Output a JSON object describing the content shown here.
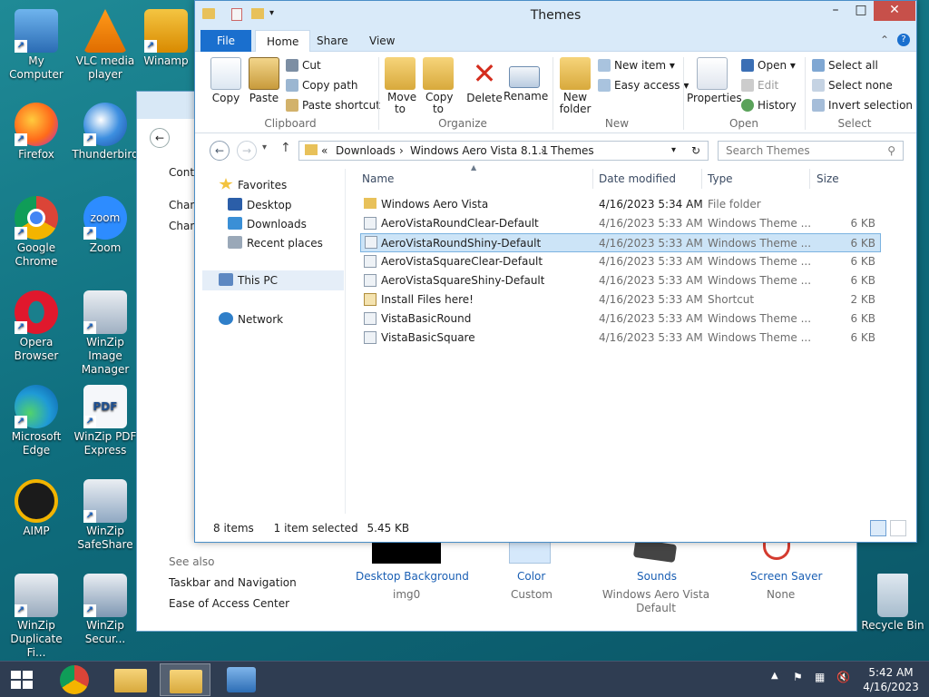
{
  "desktop": {
    "icons": [
      {
        "label": "My Computer",
        "icon": "computer-icon"
      },
      {
        "label": "VLC media player",
        "icon": "vlc-icon"
      },
      {
        "label": "Winamp",
        "icon": "winamp-icon"
      },
      {
        "label": "Firefox",
        "icon": "firefox-icon"
      },
      {
        "label": "Thunderbird",
        "icon": "thunderbird-icon"
      },
      {
        "label": "Google Chrome",
        "icon": "chrome-icon"
      },
      {
        "label": "Zoom",
        "icon": "zoom-icon"
      },
      {
        "label": "Opera Browser",
        "icon": "opera-icon"
      },
      {
        "label": "WinZip Image Manager",
        "icon": "winzip-image-icon"
      },
      {
        "label": "Microsoft Edge",
        "icon": "edge-icon"
      },
      {
        "label": "WinZip PDF Express",
        "icon": "winzip-pdf-icon"
      },
      {
        "label": "AIMP",
        "icon": "aimp-icon"
      },
      {
        "label": "WinZip SafeShare",
        "icon": "winzip-safeshare-icon"
      },
      {
        "label": "WinZip Duplicate Fi...",
        "icon": "winzip-duplicate-icon"
      },
      {
        "label": "WinZip Secur...",
        "icon": "winzip-secure-icon"
      },
      {
        "label": "Recycle Bin",
        "icon": "recycle-bin-icon"
      }
    ]
  },
  "control_panel": {
    "links": [
      "Contr",
      "Chan",
      "Chan"
    ],
    "see_also": "See also",
    "see_also_links": [
      "Taskbar and Navigation",
      "Ease of Access Center"
    ],
    "items": [
      {
        "label": "Desktop Background",
        "value": "img0"
      },
      {
        "label": "Color",
        "value": "Custom"
      },
      {
        "label": "Sounds",
        "value": "Windows Aero Vista Default"
      },
      {
        "label": "Screen Saver",
        "value": "None"
      }
    ]
  },
  "explorer": {
    "title": "Themes",
    "tabs": {
      "file": "File",
      "home": "Home",
      "share": "Share",
      "view": "View"
    },
    "ribbon": {
      "copy": "Copy",
      "paste": "Paste",
      "cut": "Cut",
      "copy_path": "Copy path",
      "paste_shortcut": "Paste shortcut",
      "clipboard": "Clipboard",
      "move_to": "Move to",
      "copy_to": "Copy to",
      "delete": "Delete",
      "rename": "Rename",
      "organize": "Organize",
      "new_folder": "New folder",
      "new_item": "New item",
      "easy_access": "Easy access",
      "new": "New",
      "properties": "Properties",
      "open": "Open",
      "edit": "Edit",
      "history": "History",
      "open_group": "Open",
      "select_all": "Select all",
      "select_none": "Select none",
      "invert_selection": "Invert selection",
      "select": "Select"
    },
    "address": {
      "prefix": "«",
      "crumbs": [
        "Downloads",
        "Windows Aero Vista 8.1.1",
        "Themes"
      ],
      "search_placeholder": "Search Themes"
    },
    "nav": {
      "favorites": "Favorites",
      "desktop": "Desktop",
      "downloads": "Downloads",
      "recent": "Recent places",
      "this_pc": "This PC",
      "network": "Network"
    },
    "columns": {
      "name": "Name",
      "date": "Date modified",
      "type": "Type",
      "size": "Size"
    },
    "files": [
      {
        "name": "Windows Aero Vista",
        "date": "4/16/2023 5:34 AM",
        "type": "File folder",
        "size": "",
        "kind": "folder"
      },
      {
        "name": "AeroVistaRoundClear-Default",
        "date": "4/16/2023 5:33 AM",
        "type": "Windows Theme ...",
        "size": "6 KB",
        "kind": "theme"
      },
      {
        "name": "AeroVistaRoundShiny-Default",
        "date": "4/16/2023 5:33 AM",
        "type": "Windows Theme ...",
        "size": "6 KB",
        "kind": "theme"
      },
      {
        "name": "AeroVistaSquareClear-Default",
        "date": "4/16/2023 5:33 AM",
        "type": "Windows Theme ...",
        "size": "6 KB",
        "kind": "theme"
      },
      {
        "name": "AeroVistaSquareShiny-Default",
        "date": "4/16/2023 5:33 AM",
        "type": "Windows Theme ...",
        "size": "6 KB",
        "kind": "theme"
      },
      {
        "name": "Install Files here!",
        "date": "4/16/2023 5:33 AM",
        "type": "Shortcut",
        "size": "2 KB",
        "kind": "shortcut"
      },
      {
        "name": "VistaBasicRound",
        "date": "4/16/2023 5:33 AM",
        "type": "Windows Theme ...",
        "size": "6 KB",
        "kind": "theme"
      },
      {
        "name": "VistaBasicSquare",
        "date": "4/16/2023 5:33 AM",
        "type": "Windows Theme ...",
        "size": "6 KB",
        "kind": "theme"
      }
    ],
    "status": {
      "count": "8 items",
      "selected": "1 item selected",
      "size": "5.45 KB"
    }
  },
  "taskbar": {
    "time": "5:42 AM",
    "date": "4/16/2023"
  },
  "colors": {
    "accent": "#1a6fce",
    "selection": "#cce4f7",
    "taskbar": "#2f3d52"
  }
}
